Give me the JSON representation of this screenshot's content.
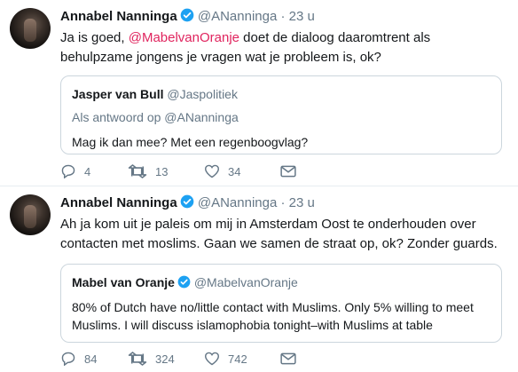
{
  "tweets": [
    {
      "author_name": "Annabel Nanninga",
      "handle": "@ANanninga",
      "separator": "·",
      "time": "23 u",
      "text_before": "Ja is goed, ",
      "mention": "@MabelvanOranje",
      "text_after": " doet de dialoog daaromtrent als behulpzame jongens je vragen wat je probleem is, ok?",
      "quote": {
        "name": "Jasper van Bull",
        "handle": "@Jaspolitiek",
        "reply_context": "Als antwoord op @ANanninga",
        "text": "Mag ik dan mee? Met een regenboogvlag?"
      },
      "actions": {
        "replies": "4",
        "retweets": "13",
        "likes": "34"
      }
    },
    {
      "author_name": "Annabel Nanninga",
      "handle": "@ANanninga",
      "separator": "·",
      "time": "23 u",
      "text": "Ah ja kom uit je paleis om mij in Amsterdam Oost te onderhouden over contacten met moslims. Gaan we samen de straat op, ok? Zonder guards.",
      "quote": {
        "name": "Mabel van Oranje",
        "handle": "@MabelvanOranje",
        "text": "80% of Dutch have no/little contact with Muslims. Only 5% willing to meet Muslims. I will discuss islamophobia tonight–with Muslims at table"
      },
      "actions": {
        "replies": "84",
        "retweets": "324",
        "likes": "742"
      }
    }
  ],
  "colors": {
    "mention": "#e0245e",
    "verified": "#1da1f2",
    "secondary_text": "#657786",
    "border": "#ccd6dd"
  },
  "icons": [
    "verified-badge-icon",
    "reply-icon",
    "retweet-icon",
    "like-icon",
    "dm-icon"
  ]
}
